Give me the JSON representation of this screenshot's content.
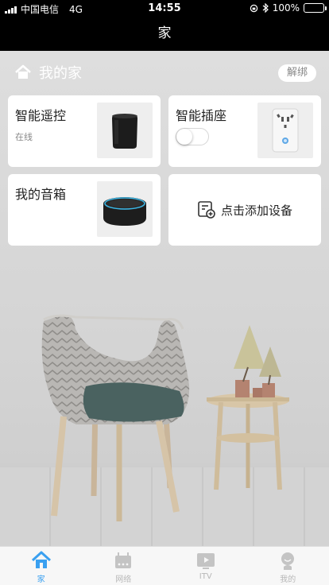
{
  "status_bar": {
    "carrier": "中国电信",
    "network": "4G",
    "time": "14:55",
    "battery": "100%"
  },
  "nav": {
    "title": "家"
  },
  "home": {
    "title": "我的家",
    "unbind_label": "解绑"
  },
  "devices": [
    {
      "name": "智能遥控",
      "status": "在线"
    },
    {
      "name": "智能插座",
      "switch_on": false
    },
    {
      "name": "我的音箱"
    }
  ],
  "add_device": {
    "label": "点击添加设备"
  },
  "tabs": [
    {
      "label": "家",
      "icon": "home-icon",
      "active": true
    },
    {
      "label": "网络",
      "icon": "router-icon",
      "active": false
    },
    {
      "label": "ITV",
      "icon": "tv-icon",
      "active": false
    },
    {
      "label": "我的",
      "icon": "profile-icon",
      "active": false
    }
  ],
  "colors": {
    "accent": "#3aa0f0",
    "nav_bg": "#000000",
    "battery_fill": "#4cd964",
    "tab_inactive": "#b8b8b8"
  }
}
